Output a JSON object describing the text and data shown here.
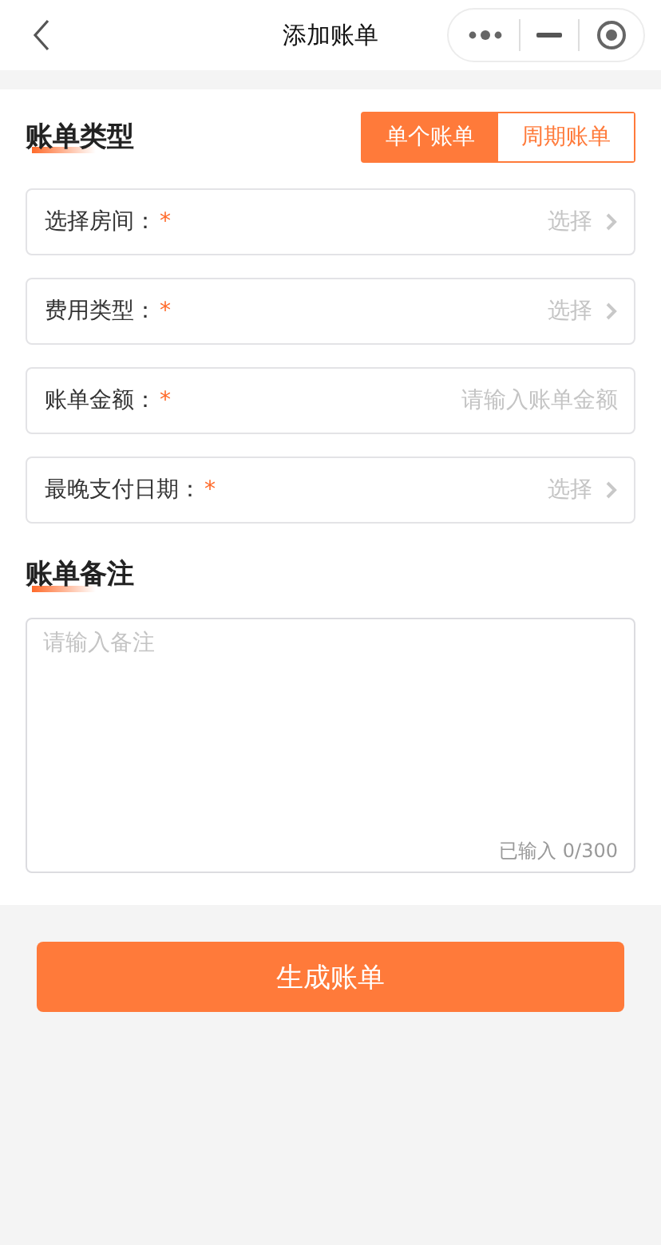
{
  "nav": {
    "title": "添加账单"
  },
  "bill_type": {
    "title": "账单类型",
    "options": [
      {
        "label": "单个账单",
        "selected": true
      },
      {
        "label": "周期账单",
        "selected": false
      }
    ]
  },
  "fields": [
    {
      "kind": "select",
      "label": "选择房间：",
      "mark": "*",
      "value": "选择"
    },
    {
      "kind": "select",
      "label": "费用类型：",
      "mark": "*",
      "value": "选择"
    },
    {
      "kind": "input",
      "label": "账单金额：",
      "mark": "*",
      "placeholder": "请输入账单金额"
    },
    {
      "kind": "select",
      "label": "最晚支付日期：",
      "mark": "*",
      "value": "选择"
    }
  ],
  "note": {
    "title": "账单备注",
    "placeholder": "请输入备注",
    "counter": "已输入 0/300"
  },
  "submit": "生成账单"
}
